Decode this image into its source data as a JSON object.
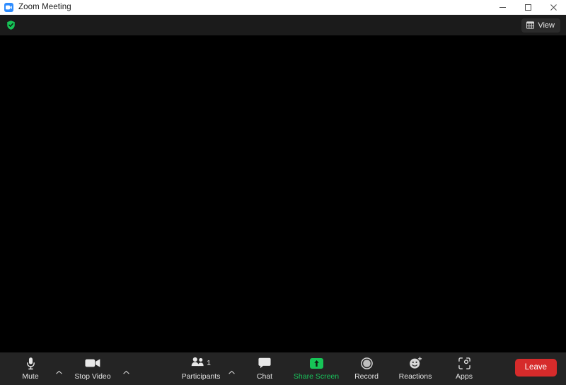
{
  "window": {
    "title": "Zoom Meeting",
    "app_icon": "zoom-video-icon",
    "controls": {
      "minimize": "minimize-icon",
      "maximize": "maximize-icon",
      "close": "close-icon"
    }
  },
  "topbar": {
    "security_icon": "green-shield-check-icon",
    "view": {
      "label": "View",
      "icon": "grid-layout-icon"
    }
  },
  "stage": {
    "background": "#000000"
  },
  "toolbar": {
    "background": "#242424",
    "items": [
      {
        "label": "Mute",
        "icon": "microphone-icon",
        "caret": true,
        "accent": false
      },
      {
        "label": "Stop Video",
        "icon": "video-camera-icon",
        "caret": true,
        "accent": false
      },
      {
        "label": "Participants",
        "icon": "participants-icon",
        "caret": true,
        "accent": false,
        "count": "1"
      },
      {
        "label": "Chat",
        "icon": "chat-bubble-icon",
        "caret": false,
        "accent": false
      },
      {
        "label": "Share Screen",
        "icon": "share-screen-icon",
        "caret": false,
        "accent": true
      },
      {
        "label": "Record",
        "icon": "record-circle-icon",
        "caret": false,
        "accent": false
      },
      {
        "label": "Reactions",
        "icon": "reactions-smiley-plus-icon",
        "caret": false,
        "accent": false
      },
      {
        "label": "Apps",
        "icon": "apps-bracket-icon",
        "caret": false,
        "accent": false
      }
    ],
    "leave": {
      "label": "Leave",
      "color": "#d62b2b"
    }
  },
  "colors": {
    "accent_green": "#17c457",
    "leave_red": "#d62b2b",
    "zoom_blue": "#2d8cff",
    "toolbar_bg": "#242424",
    "topbar_bg": "#1b1b1b",
    "stage_bg": "#000000",
    "titlebar_bg": "#ffffff"
  }
}
